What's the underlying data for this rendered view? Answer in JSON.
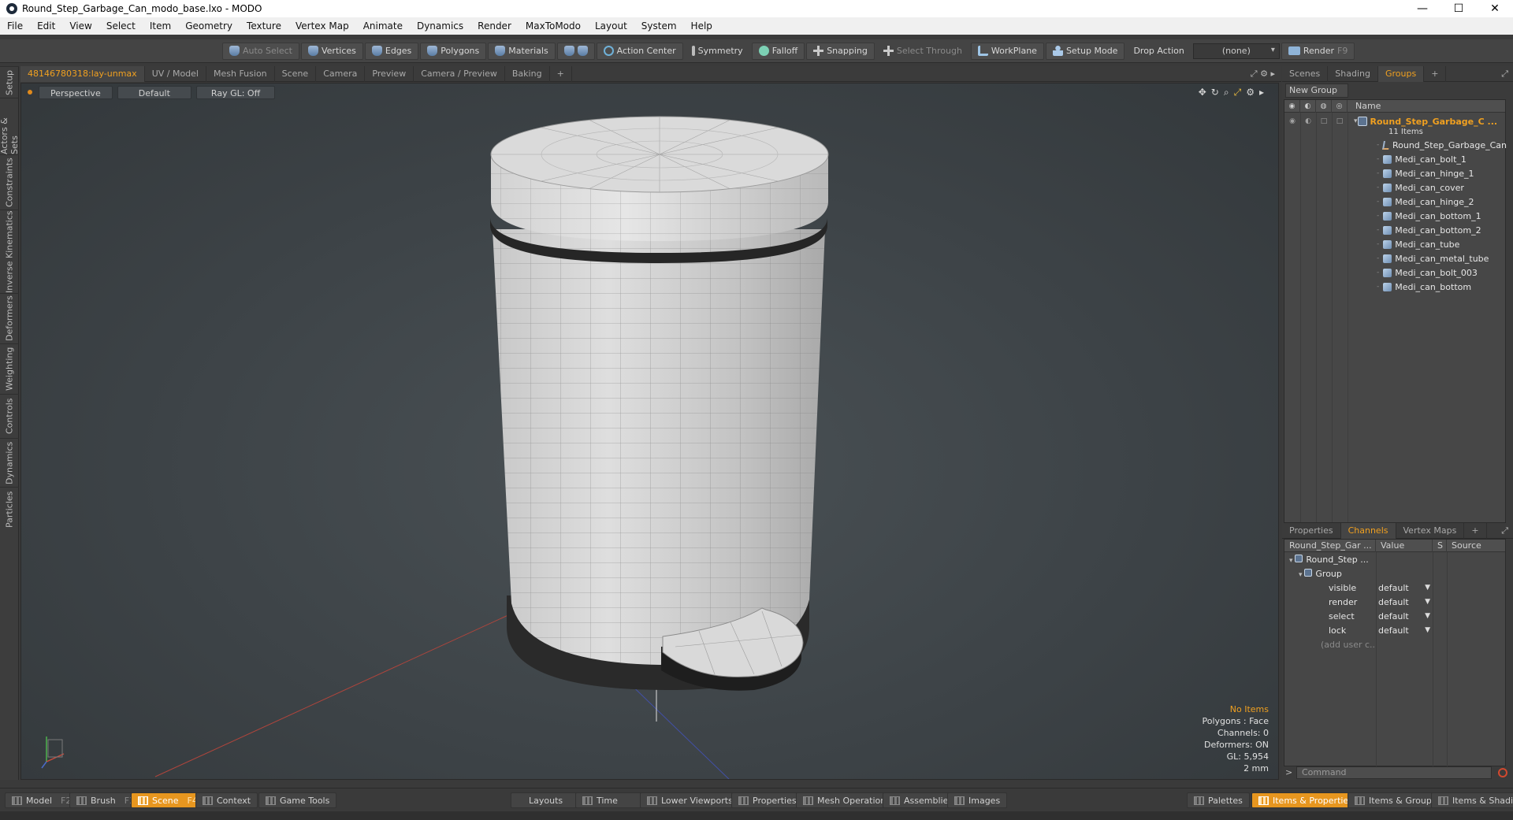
{
  "window": {
    "title": "Round_Step_Garbage_Can_modo_base.lxo - MODO",
    "minimize": "—",
    "maximize": "☐",
    "close": "✕"
  },
  "menu": [
    "File",
    "Edit",
    "View",
    "Select",
    "Item",
    "Geometry",
    "Texture",
    "Vertex Map",
    "Animate",
    "Dynamics",
    "Render",
    "MaxToModo",
    "Layout",
    "System",
    "Help"
  ],
  "toolbar": {
    "auto_select": "Auto Select",
    "vertices": "Vertices",
    "edges": "Edges",
    "polygons": "Polygons",
    "materials": "Materials",
    "action_center": "Action Center",
    "symmetry": "Symmetry",
    "falloff": "Falloff",
    "snapping": "Snapping",
    "select_through": "Select Through",
    "workplane": "WorkPlane",
    "setup_mode": "Setup Mode",
    "drop_action": "Drop Action",
    "drop_value": "(none)",
    "render": "Render",
    "render_key": "F9"
  },
  "left_tabs": [
    "Setup",
    "Actors & Sets",
    "Constraints",
    "Inverse Kinematics",
    "Deformers",
    "Weighting",
    "Controls",
    "Dynamics",
    "Particles"
  ],
  "viewport_tabs": [
    "48146780318:lay-unmax",
    "UV / Model",
    "Mesh Fusion",
    "Scene",
    "Camera",
    "Preview",
    "Camera / Preview",
    "Baking",
    "+"
  ],
  "viewport": {
    "view": "Perspective",
    "shading": "Default",
    "raygl": "Ray GL: Off",
    "info": {
      "items": "No Items",
      "polygons": "Polygons : Face",
      "channels": "Channels: 0",
      "deformers": "Deformers: ON",
      "gl": "GL: 5,954",
      "scale": "2 mm"
    }
  },
  "right_tabs": [
    "Scenes",
    "Shading",
    "Groups",
    "+"
  ],
  "groups": {
    "new_group": "New Group",
    "name_header": "Name",
    "root": "Round_Step_Garbage_C ...",
    "root_count": "11 Items",
    "items": [
      {
        "name": "Round_Step_Garbage_Can",
        "icon": "locator-icon"
      },
      {
        "name": "Medi_can_bolt_1",
        "icon": "mesh-icon"
      },
      {
        "name": "Medi_can_hinge_1",
        "icon": "mesh-icon"
      },
      {
        "name": "Medi_can_cover",
        "icon": "mesh-icon"
      },
      {
        "name": "Medi_can_hinge_2",
        "icon": "mesh-icon"
      },
      {
        "name": "Medi_can_bottom_1",
        "icon": "mesh-icon"
      },
      {
        "name": "Medi_can_bottom_2",
        "icon": "mesh-icon"
      },
      {
        "name": "Medi_can_tube",
        "icon": "mesh-icon"
      },
      {
        "name": "Medi_can_metal_tube",
        "icon": "mesh-icon"
      },
      {
        "name": "Medi_can_bolt_003",
        "icon": "mesh-icon"
      },
      {
        "name": "Medi_can_bottom",
        "icon": "mesh-icon"
      }
    ]
  },
  "props_tabs": [
    "Properties",
    "Channels",
    "Vertex Maps",
    "+"
  ],
  "channels": {
    "headers": [
      "Round_Step_Gar ...",
      "Value",
      "S",
      "Source"
    ],
    "root": "Round_Step ...",
    "group": "Group",
    "rows": [
      {
        "name": "visible",
        "value": "default"
      },
      {
        "name": "render",
        "value": "default"
      },
      {
        "name": "select",
        "value": "default"
      },
      {
        "name": "lock",
        "value": "default"
      }
    ],
    "add_user": "(add user c..."
  },
  "command": {
    "prompt": ">",
    "placeholder": "Command"
  },
  "bottom": {
    "model": "Model",
    "model_key": "F2",
    "brush": "Brush",
    "brush_key": "F3",
    "scene": "Scene",
    "scene_key": "F4",
    "context": "Context",
    "game_tools": "Game Tools",
    "layouts": "Layouts",
    "time": "Time",
    "lower_viewports": "Lower Viewports",
    "properties": "Properties",
    "mesh_operations": "Mesh Operations",
    "assemblies": "Assemblies",
    "images": "Images",
    "palettes": "Palettes",
    "items_properties": "Items & Properties",
    "items_groups": "Items & Groups",
    "items_shading": "Items & Shading"
  },
  "colors": {
    "accent": "#f0a020",
    "active_button": "#e7961f"
  }
}
